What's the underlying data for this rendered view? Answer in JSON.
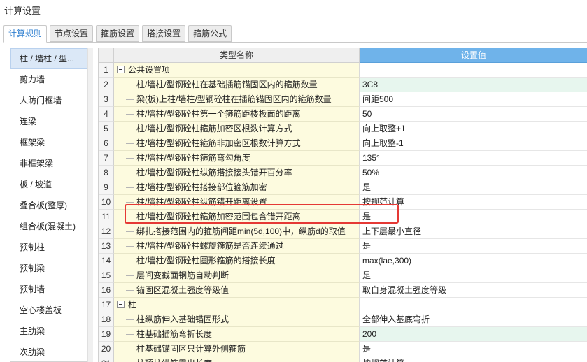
{
  "window": {
    "title": "计算设置"
  },
  "tabs": [
    {
      "label": "计算规则",
      "active": true
    },
    {
      "label": "节点设置",
      "active": false
    },
    {
      "label": "箍筋设置",
      "active": false
    },
    {
      "label": "搭接设置",
      "active": false
    },
    {
      "label": "箍筋公式",
      "active": false
    }
  ],
  "sidebar": {
    "items": [
      {
        "label": "柱 / 墙柱 / 型...",
        "active": true
      },
      {
        "label": "剪力墙"
      },
      {
        "label": "人防门框墙"
      },
      {
        "label": "连梁"
      },
      {
        "label": "框架梁"
      },
      {
        "label": "非框架梁"
      },
      {
        "label": "板 / 坡道"
      },
      {
        "label": "叠合板(整厚)"
      },
      {
        "label": "组合板(混凝土)"
      },
      {
        "label": "预制柱"
      },
      {
        "label": "预制梁"
      },
      {
        "label": "预制墙"
      },
      {
        "label": "空心楼盖板"
      },
      {
        "label": "主肋梁"
      },
      {
        "label": "次肋梁"
      }
    ]
  },
  "grid": {
    "header": {
      "name": "类型名称",
      "value": "设置值"
    },
    "rows": [
      {
        "num": "1",
        "name": "公共设置项",
        "value": "",
        "group": true
      },
      {
        "num": "2",
        "name": "柱/墙柱/型钢砼柱在基础插筋锚固区内的箍筋数量",
        "value": "3C8",
        "highlight": true
      },
      {
        "num": "3",
        "name": "梁(板)上柱/墙柱/型钢砼柱在插筋锚固区内的箍筋数量",
        "value": "间距500"
      },
      {
        "num": "4",
        "name": "柱/墙柱/型钢砼柱第一个箍筋距楼板面的距离",
        "value": "50"
      },
      {
        "num": "5",
        "name": "柱/墙柱/型钢砼柱箍筋加密区根数计算方式",
        "value": "向上取整+1"
      },
      {
        "num": "6",
        "name": "柱/墙柱/型钢砼柱箍筋非加密区根数计算方式",
        "value": "向上取整-1"
      },
      {
        "num": "7",
        "name": "柱/墙柱/型钢砼柱箍筋弯勾角度",
        "value": "135°"
      },
      {
        "num": "8",
        "name": "柱/墙柱/型钢砼柱纵筋搭接接头错开百分率",
        "value": "50%"
      },
      {
        "num": "9",
        "name": "柱/墙柱/型钢砼柱搭接部位箍筋加密",
        "value": "是"
      },
      {
        "num": "10",
        "name": "柱/墙柱/型钢砼柱纵筋错开距离设置",
        "value": "按规范计算"
      },
      {
        "num": "11",
        "name": "柱/墙柱/型钢砼柱箍筋加密范围包含错开距离",
        "value": "是"
      },
      {
        "num": "12",
        "name": "绑扎搭接范围内的箍筋间距min(5d,100)中，纵筋d的取值",
        "value": "上下层最小直径"
      },
      {
        "num": "13",
        "name": "柱/墙柱/型钢砼柱螺旋箍筋是否连续通过",
        "value": "是"
      },
      {
        "num": "14",
        "name": "柱/墙柱/型钢砼柱圆形箍筋的搭接长度",
        "value": "max(lae,300)"
      },
      {
        "num": "15",
        "name": "层间变截面钢筋自动判断",
        "value": "是"
      },
      {
        "num": "16",
        "name": "锚固区混凝土强度等级值",
        "value": "取自身混凝土强度等级"
      },
      {
        "num": "17",
        "name": "柱",
        "value": "",
        "group": true
      },
      {
        "num": "18",
        "name": "柱纵筋伸入基础锚固形式",
        "value": "全部伸入基底弯折"
      },
      {
        "num": "19",
        "name": "柱基础插筋弯折长度",
        "value": "200",
        "highlight": true
      },
      {
        "num": "20",
        "name": "柱基础锚固区只计算外侧箍筋",
        "value": "是"
      },
      {
        "num": "21",
        "name": "柱顶柱纵筋露出长度",
        "value": "按规范计算"
      }
    ]
  }
}
